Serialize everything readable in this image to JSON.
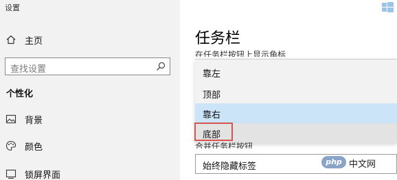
{
  "window": {
    "title": "设置"
  },
  "nav": {
    "home_label": "主页",
    "search_placeholder": "查找设置",
    "section_label": "个性化",
    "items": [
      {
        "label": "背景",
        "icon": "image-icon"
      },
      {
        "label": "颜色",
        "icon": "palette-icon"
      },
      {
        "label": "锁屏界面",
        "icon": "lock-screen-icon"
      }
    ]
  },
  "content": {
    "title": "任务栏",
    "setting_label_top": "在任务栏按钮上显示角标",
    "dropdown_options": [
      "靠左",
      "顶部",
      "靠右",
      "底部"
    ],
    "dropdown_selected_index": 2,
    "dropdown_highlighted_index": 3,
    "setting_label_bottom": "合并任务栏按钮",
    "combine_value": "始终隐藏标签"
  },
  "watermark": {
    "logo_text": "php",
    "text": "中文网"
  },
  "colors": {
    "nav_bg": "#f2f2f2",
    "selected_bg": "#cce4f7",
    "highlight_border": "#d9534f"
  }
}
